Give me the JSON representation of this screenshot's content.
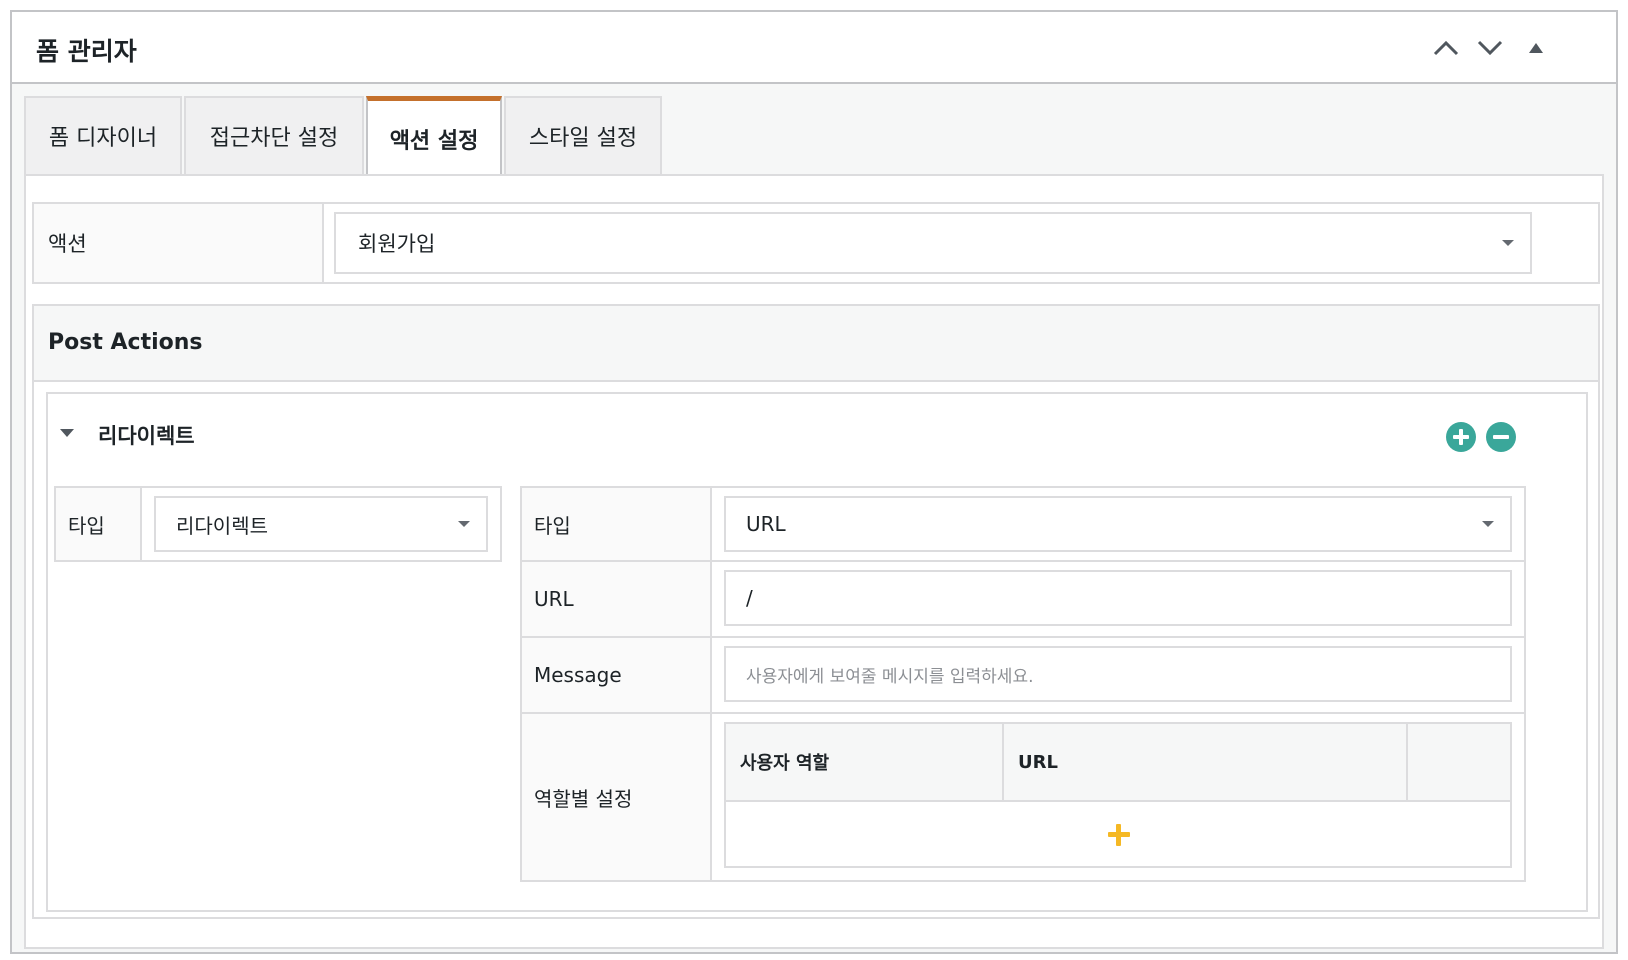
{
  "panel": {
    "title": "폼 관리자",
    "move_up_icon": "chevron-up-icon",
    "move_down_icon": "chevron-down-icon",
    "collapse_icon": "triangle-up-icon"
  },
  "tabs": [
    {
      "label": "폼 디자이너",
      "active": false
    },
    {
      "label": "접근차단 설정",
      "active": false
    },
    {
      "label": "액션 설정",
      "active": true
    },
    {
      "label": "스타일 설정",
      "active": false
    }
  ],
  "action": {
    "label": "액션",
    "selected": "회원가입"
  },
  "post_actions": {
    "title": "Post Actions",
    "redirect": {
      "title": "리다이렉트",
      "add_icon": "plus-circle-icon",
      "remove_icon": "minus-circle-icon",
      "left": {
        "type_label": "타입",
        "type_selected": "리다이렉트"
      },
      "right": {
        "type_label": "타입",
        "type_selected": "URL",
        "url_label": "URL",
        "url_value": "/",
        "message_label": "Message",
        "message_placeholder": "사용자에게 보여줄 메시지를 입력하세요.",
        "role_label": "역할별 설정",
        "role_table": {
          "columns": [
            "사용자 역할",
            "URL",
            ""
          ],
          "add_icon": "plus-icon"
        }
      }
    }
  },
  "colors": {
    "active_tab_accent": "#c4702c",
    "circle_button": "#3aa79a",
    "add_role_plus": "#f5b824"
  }
}
